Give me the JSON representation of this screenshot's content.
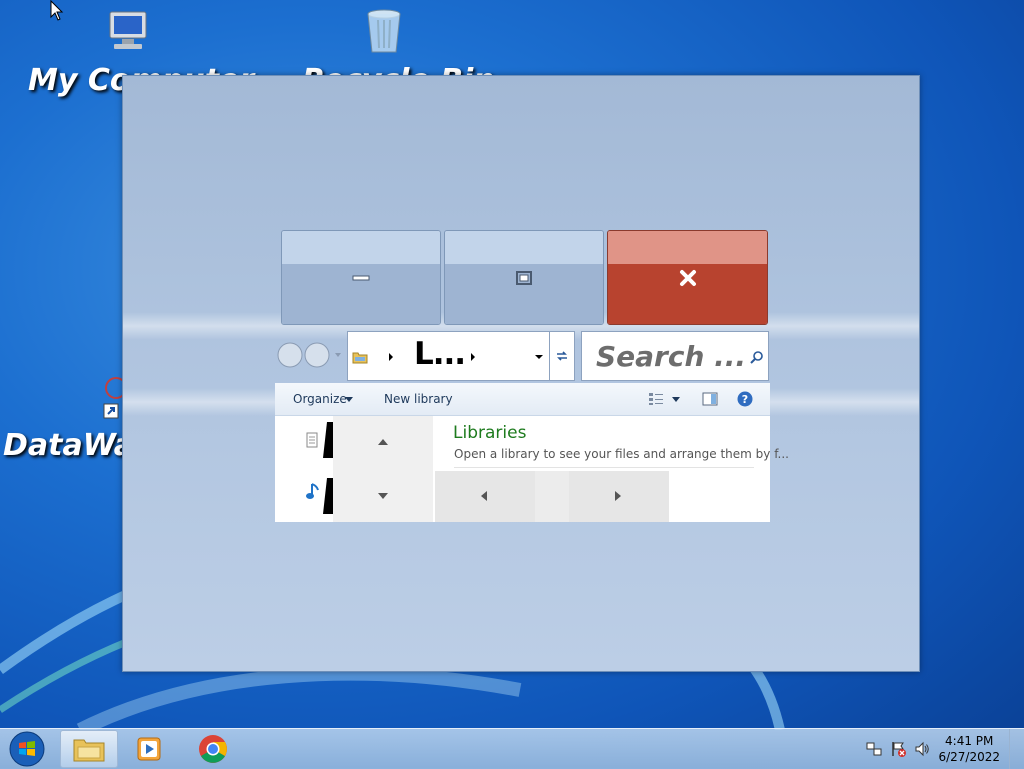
{
  "desktop": {
    "icons": [
      {
        "label": "My Computer",
        "icon": "computer-icon"
      },
      {
        "label": "Recycle Bin",
        "icon": "recycle-bin-icon"
      },
      {
        "label": "DataWa",
        "icon": "shortcut-icon"
      }
    ]
  },
  "window": {
    "caption": {
      "minimize": "minimize-icon",
      "maximize": "maximize-icon",
      "close": "close-icon",
      "close_color": "#b8432f"
    },
    "address": {
      "text": "L..."
    },
    "search": {
      "placeholder": "Search ..."
    },
    "toolbar": {
      "organize": "Organize",
      "new_library": "New library"
    },
    "content": {
      "title": "Libraries",
      "description": "Open a library to see your files and arrange them by f..."
    }
  },
  "taskbar": {
    "time": "4:41 PM",
    "date": "6/27/2022"
  }
}
